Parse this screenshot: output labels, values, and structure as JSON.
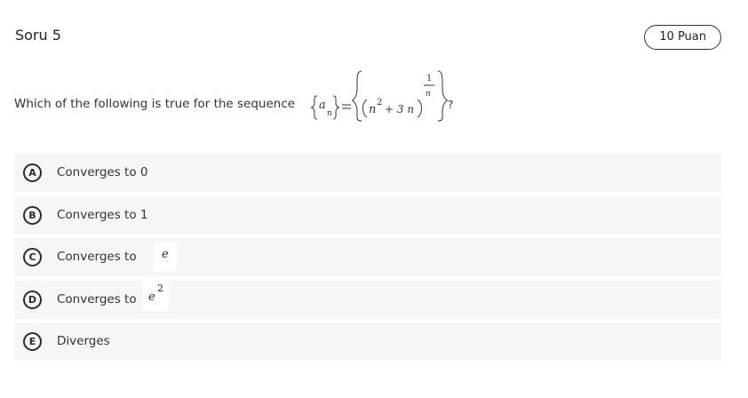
{
  "header": {
    "title": "Soru 5",
    "points": "10 Puan"
  },
  "question": {
    "text": "Which of the following is true for the sequence",
    "formula_lhs_var": "a",
    "formula_lhs_sub": "n",
    "formula_base": "n",
    "formula_base_exp": "2",
    "formula_plus_term": "+ 3 n",
    "formula_exp_num": "1",
    "formula_exp_den": "n",
    "end_mark": "?"
  },
  "options": [
    {
      "letter": "A",
      "text": "Converges to 0"
    },
    {
      "letter": "B",
      "text": "Converges to 1"
    },
    {
      "letter": "C",
      "text": "Converges to",
      "math": "e"
    },
    {
      "letter": "D",
      "text": "Converges to",
      "math": "e",
      "math_exp": "2"
    },
    {
      "letter": "E",
      "text": "Diverges"
    }
  ]
}
